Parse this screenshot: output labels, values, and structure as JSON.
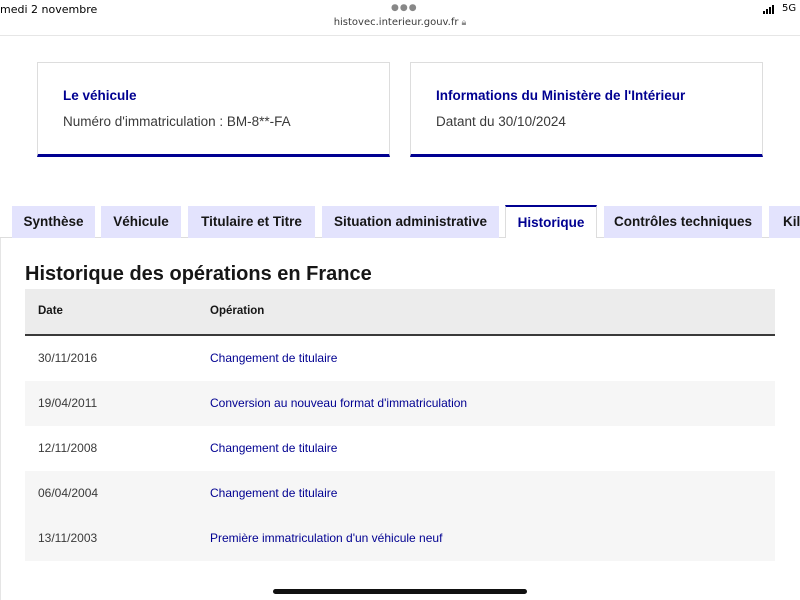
{
  "status_bar": {
    "time_date": "medi 2 novembre",
    "url": "histovec.interieur.gouv.fr",
    "network": "5G",
    "signal_icon": "signal-bars-icon",
    "lock_icon": "lock-icon"
  },
  "cards": {
    "vehicle": {
      "title": "Le véhicule",
      "text": "Numéro d'immatriculation : BM-8**-FA"
    },
    "ministry": {
      "title": "Informations du Ministère de l'Intérieur",
      "text": "Datant du 30/10/2024"
    }
  },
  "tabs": [
    {
      "label": "Synthèse",
      "active": false
    },
    {
      "label": "Véhicule",
      "active": false
    },
    {
      "label": "Titulaire et Titre",
      "active": false
    },
    {
      "label": "Situation administrative",
      "active": false
    },
    {
      "label": "Historique",
      "active": true
    },
    {
      "label": "Contrôles techniques",
      "active": false
    },
    {
      "label": "Kilo",
      "active": false
    }
  ],
  "history": {
    "title": "Historique des opérations en France",
    "columns": {
      "date": "Date",
      "operation": "Opération"
    },
    "rows": [
      {
        "date": "30/11/2016",
        "operation": "Changement de titulaire"
      },
      {
        "date": "19/04/2011",
        "operation": "Conversion au nouveau format d'immatriculation"
      },
      {
        "date": "12/11/2008",
        "operation": "Changement de titulaire"
      },
      {
        "date": "06/04/2004",
        "operation": "Changement de titulaire"
      },
      {
        "date": "13/11/2003",
        "operation": "Première immatriculation d'un véhicule neuf"
      }
    ]
  },
  "colors": {
    "accent": "#000091",
    "tab_background": "#e3e3fd",
    "table_header": "#ececec",
    "row_alt": "#f6f6f6"
  }
}
